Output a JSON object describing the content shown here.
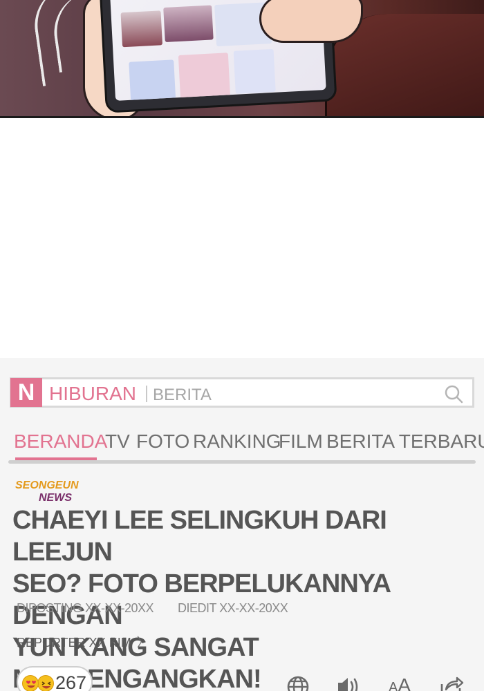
{
  "app": {
    "logo_letter": "N",
    "section": "HIBURAN",
    "subsection": "BERITA"
  },
  "nav": {
    "items": [
      "BERANDA",
      "TV",
      "FOTO",
      "RANKING",
      "FILM",
      "BERITA TERBARU"
    ],
    "active_index": 0
  },
  "article": {
    "brand_line1": "SEONGEUN",
    "brand_line2": "NEWS",
    "headline_line1": "CHAEYI LEE SELINGKUH DARI LEEJUN",
    "headline_line2": "SEO?  FOTO BERPELUKANNYA DENGAN",
    "headline_line3": "YUN KANG SANGAT MENCENGANGKAN!",
    "posted": "DIPOSTING XX-XX-20XX",
    "edited": "DIEDIT XX-XX-20XX",
    "reporter": "REPORTER XX KIM",
    "reporter_chevron": "〉"
  },
  "reactions": {
    "count": "267",
    "icons": [
      "heart-eyes-emoji",
      "laughing-emoji"
    ]
  },
  "toolbar": {
    "icons": [
      "globe-icon",
      "speaker-icon",
      "font-size-icon",
      "share-icon"
    ],
    "font_small": "A",
    "font_large": "A"
  },
  "colors": {
    "accent_pink": "#e27390",
    "brand_orange": "#e49a1d",
    "brand_purple": "#7a2f6a",
    "headline_gray": "#555555"
  }
}
